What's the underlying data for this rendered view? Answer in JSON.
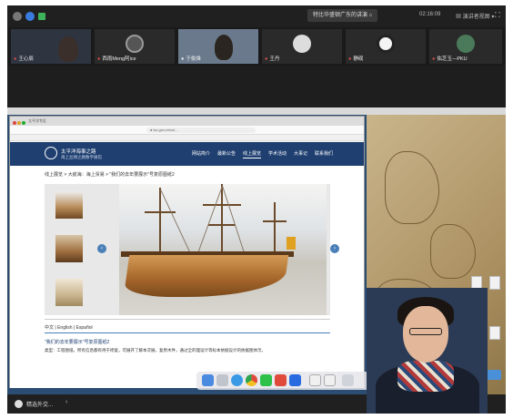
{
  "meeting": {
    "title_badge": "特比华盛顿广东的讲演 ⌂",
    "time": "02:16:09",
    "view_label": "▦ 演讲者视图 ▾",
    "fullscreen": "⛶"
  },
  "participants": [
    {
      "name": "王心辰"
    },
    {
      "name": "西雨Meng阿ice"
    },
    {
      "name": "于俊烽"
    },
    {
      "name": "王丹"
    },
    {
      "name": "静砚"
    },
    {
      "name": "佑芝玉—PKU"
    }
  ],
  "browser": {
    "url": "● lsz.gov.cn/cs/...",
    "tabs": "太平洋专区"
  },
  "site": {
    "logo_line1": "太平洋海事之路",
    "logo_line2": "海上丝绸之路数字展馆",
    "nav": [
      "网站简介",
      "最新公告",
      "线上展览",
      "学术活动",
      "大事记",
      "联系我们"
    ],
    "breadcrumb": "线上展览 > 大航海：海上贸易 > \"我们的去年要展示\"号复原图纸2",
    "lang_switch": "中文 | English | Español",
    "caption_title": "\"我们的去年要展示\"号复原图纸2",
    "caption_body": "类型：工程图纸。所有信息都有待于修复，可展开了解本次展，复原木件，通过全的理设计等标本依据设计的依据图体示。"
  },
  "bottom": {
    "label": "精选外交...",
    "back": "‹"
  },
  "colors": {
    "nav_bg": "#1f3f70",
    "accent": "#4a7fb8"
  }
}
